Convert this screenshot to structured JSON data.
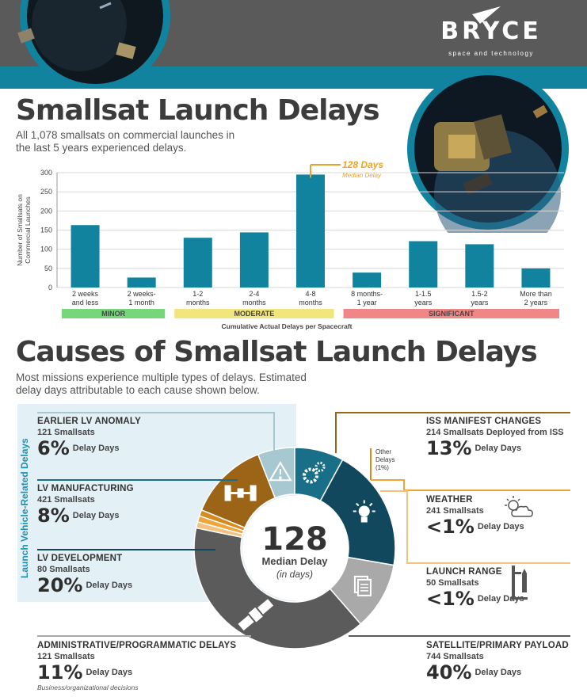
{
  "header": {
    "brand_name": "BRYCE",
    "brand_tagline": "space and technology",
    "colors": {
      "dark": "#5a5a5a",
      "teal": "#12839f"
    }
  },
  "section1": {
    "title": "Smallsat Launch Delays",
    "subtitle_line1": "All 1,078 smallsats on commercial launches in",
    "subtitle_line2": "the last 5 years experienced delays."
  },
  "chart_data": {
    "type": "bar",
    "categories": [
      "2 weeks and less",
      "2 weeks-1 month",
      "1-2 months",
      "2-4 months",
      "4-8 months",
      "8 months-1 year",
      "1-1.5 years",
      "1.5-2 years",
      "More than 2 years"
    ],
    "category_lines": [
      [
        "2 weeks",
        "and less"
      ],
      [
        "2 weeks-",
        "1 month"
      ],
      [
        "1-2",
        "months"
      ],
      [
        "2-4",
        "months"
      ],
      [
        "4-8",
        "months"
      ],
      [
        "8 months-",
        "1 year"
      ],
      [
        "1-1.5",
        "years"
      ],
      [
        "1.5-2",
        "years"
      ],
      [
        "More than",
        "2 years"
      ]
    ],
    "values": [
      163,
      26,
      130,
      144,
      295,
      39,
      121,
      113,
      50
    ],
    "ylabel_line1": "Number of Smallsats on",
    "ylabel_line2": "Commercial Launches",
    "xlabel": "Cumulative Actual Delays per Spacecraft",
    "ylim": [
      0,
      300
    ],
    "yticks": [
      0,
      50,
      100,
      150,
      200,
      250,
      300
    ],
    "grid": true,
    "bar_color": "#12839f",
    "annotation": {
      "value": "128 Days",
      "label": "Median Delay",
      "category": "4-8 months",
      "color": "#e8a52a"
    },
    "groups": [
      {
        "label": "MINOR",
        "from": 0,
        "to": 1,
        "color": "#77d67a"
      },
      {
        "label": "MODERATE",
        "from": 2,
        "to": 4,
        "color": "#f2e57c"
      },
      {
        "label": "SIGNIFICANT",
        "from": 5,
        "to": 8,
        "color": "#f18686"
      }
    ]
  },
  "section2": {
    "title": "Causes of Smallsat Launch Delays",
    "subtitle_line1": "Most missions experience multiple types of delays. Estimated",
    "subtitle_line2": "delay days attributable to each cause shown below.",
    "lv_group_label": "Launch Vehicle-Related Delays",
    "center_value": "128",
    "center_label": "Median Delay",
    "center_unit": "(in days)",
    "other_label_lines": [
      "Other",
      "Delays",
      "(1%)"
    ],
    "delay_days_label": "Delay Days",
    "causes": [
      {
        "name": "EARLIER LV ANOMALY",
        "count": "121 Smallsats",
        "pct": "6%",
        "share": 6,
        "color": "#a7c8d1",
        "icon": "warning-icon"
      },
      {
        "name": "LV MANUFACTURING",
        "count": "421 Smallsats",
        "pct": "8%",
        "share": 8,
        "color": "#1a6f88",
        "icon": "gears-icon"
      },
      {
        "name": "LV DEVELOPMENT",
        "count": "80 Smallsats",
        "pct": "20%",
        "share": 20,
        "color": "#12485d",
        "icon": "lightbulb-icon"
      },
      {
        "name": "ADMINISTRATIVE/PROGRAMMATIC DELAYS",
        "count": "121 Smallsats",
        "pct": "11%",
        "share": 11,
        "color": "#a9a9a9",
        "icon": "documents-icon",
        "note": "Business/organizational decisions"
      },
      {
        "name": "SATELLITE/PRIMARY PAYLOAD",
        "count": "744 Smallsats",
        "pct": "40%",
        "share": 40,
        "color": "#5b5b5b",
        "icon": "satellite-icon"
      },
      {
        "name": "LAUNCH RANGE",
        "count": "50 Smallsats",
        "pct": "<1%",
        "share": 1,
        "color": "#f2c27e",
        "icon": "launch-range-icon"
      },
      {
        "name": "WEATHER",
        "count": "241 Smallsats",
        "pct": "<1%",
        "share": 1,
        "color": "#efa53b",
        "icon": "weather-icon"
      },
      {
        "name": "OTHER DELAYS",
        "share": 1,
        "color": "#d98a1e"
      },
      {
        "name": "ISS MANIFEST CHANGES",
        "count": "214 Smallsats Deployed from ISS",
        "pct": "13%",
        "share": 13,
        "color": "#9c6416",
        "icon": "space-station-icon"
      }
    ]
  }
}
